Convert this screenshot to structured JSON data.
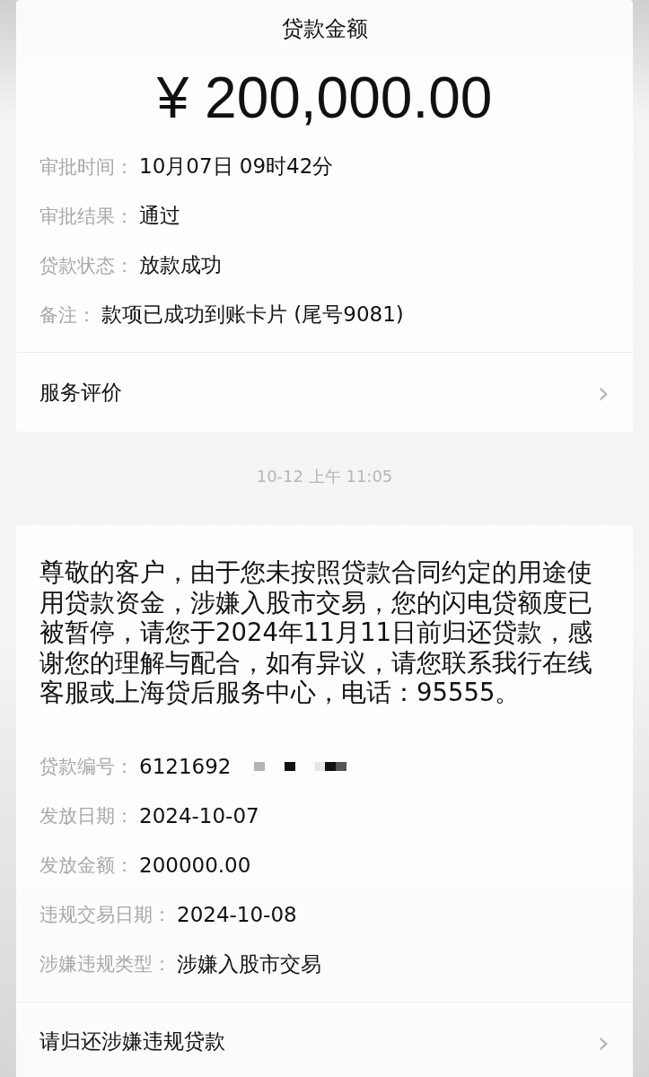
{
  "loan_card": {
    "title": "贷款金额",
    "amount": "¥ 200,000.00",
    "details": [
      {
        "label": "审批时间：",
        "value": "10月07日 09时42分"
      },
      {
        "label": "审批结果：",
        "value": "通过"
      },
      {
        "label": "贷款状态：",
        "value": "放款成功"
      },
      {
        "label": "备注：",
        "value": "款项已成功到账卡片 (尾号9081)"
      }
    ],
    "link": {
      "label": "服务评价",
      "chevron": "›"
    }
  },
  "timestamp": "10-12 上午 11:05",
  "notice_card": {
    "message": "尊敬的客户，由于您未按照贷款合同约定的用途使用贷款资金，涉嫌入股市交易，您的闪电贷额度已被暂停，请您于2024年11月11日前归还贷款，感谢您的理解与配合，如有异议，请您联系我行在线客服或上海贷后服务中心，电话：95555。",
    "details": [
      {
        "label": "贷款编号：",
        "value": "6121692",
        "redacted": true
      },
      {
        "label": "发放日期：",
        "value": "2024-10-07",
        "redacted": false
      },
      {
        "label": "发放金额：",
        "value": "200000.00",
        "redacted": false
      },
      {
        "label": "违规交易日期：",
        "value": "2024-10-08",
        "redacted": false
      },
      {
        "label": "涉嫌违规类型：",
        "value": "涉嫌入股市交易",
        "redacted": false
      }
    ],
    "link": {
      "label": "请归还涉嫌违规贷款",
      "chevron": "›"
    }
  }
}
